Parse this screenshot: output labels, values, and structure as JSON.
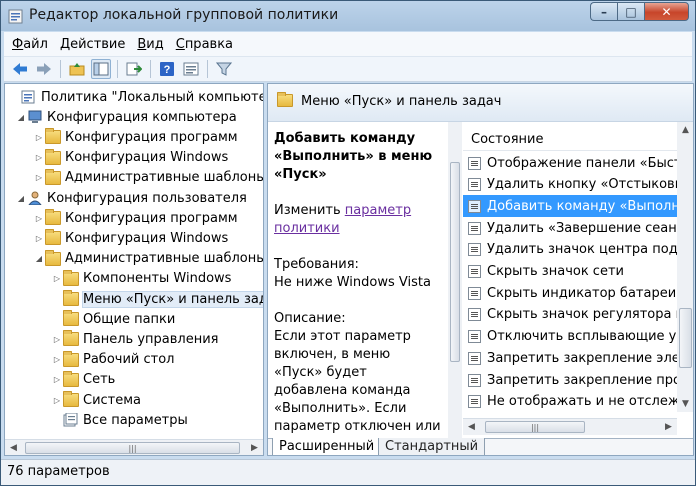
{
  "window": {
    "title": "Редактор локальной групповой политики",
    "controls": {
      "minimize": "–",
      "maximize": "□",
      "close": "✕"
    }
  },
  "menu": [
    {
      "label": "Файл",
      "accel": "Ф",
      "rest": "айл"
    },
    {
      "label": "Действие",
      "accel": "Д",
      "rest": "ействие"
    },
    {
      "label": "Вид",
      "accel": "В",
      "rest": "ид"
    },
    {
      "label": "Справка",
      "accel": "С",
      "rest": "правка"
    }
  ],
  "toolbar": {
    "buttons": [
      "back-arrow-icon",
      "forward-arrow-icon",
      "up-folder-icon",
      "show-hide-tree-icon",
      "export-list-icon",
      "help-icon",
      "properties-icon",
      "filter-icon"
    ]
  },
  "tree": {
    "items": [
      {
        "label": "Политика \"Локальный компьютер\"",
        "icon": "policy-icon",
        "depth": 0,
        "expander": ""
      },
      {
        "label": "Конфигурация компьютера",
        "icon": "computer-icon",
        "depth": 1,
        "expander": "◢"
      },
      {
        "label": "Конфигурация программ",
        "icon": "folder-icon",
        "depth": 2,
        "expander": "▷"
      },
      {
        "label": "Конфигурация Windows",
        "icon": "folder-icon",
        "depth": 2,
        "expander": "▷"
      },
      {
        "label": "Административные шаблоны",
        "icon": "folder-icon",
        "depth": 2,
        "expander": "▷"
      },
      {
        "label": "Конфигурация пользователя",
        "icon": "user-icon",
        "depth": 1,
        "expander": "◢"
      },
      {
        "label": "Конфигурация программ",
        "icon": "folder-icon",
        "depth": 2,
        "expander": "▷"
      },
      {
        "label": "Конфигурация Windows",
        "icon": "folder-icon",
        "depth": 2,
        "expander": "▷"
      },
      {
        "label": "Административные шаблоны",
        "icon": "folder-icon",
        "depth": 2,
        "expander": "◢"
      },
      {
        "label": "Компоненты Windows",
        "icon": "folder-icon",
        "depth": 3,
        "expander": "▷"
      },
      {
        "label": "Меню «Пуск» и панель задач",
        "icon": "folder-icon",
        "depth": 3,
        "expander": "",
        "selected": true
      },
      {
        "label": "Общие папки",
        "icon": "folder-icon",
        "depth": 3,
        "expander": ""
      },
      {
        "label": "Панель управления",
        "icon": "folder-icon",
        "depth": 3,
        "expander": "▷"
      },
      {
        "label": "Рабочий стол",
        "icon": "folder-icon",
        "depth": 3,
        "expander": "▷"
      },
      {
        "label": "Сеть",
        "icon": "folder-icon",
        "depth": 3,
        "expander": "▷"
      },
      {
        "label": "Система",
        "icon": "folder-icon",
        "depth": 3,
        "expander": "▷"
      },
      {
        "label": "Все параметры",
        "icon": "all-settings-icon",
        "depth": 3,
        "expander": ""
      }
    ]
  },
  "right": {
    "header_title": "Меню «Пуск» и панель задач",
    "description": {
      "title": "Добавить команду «Выполнить» в меню «Пуск»",
      "edit_prefix": "Изменить ",
      "edit_link": "параметр политики",
      "req_label": "Требования:",
      "req_value": "Не ниже Windows Vista",
      "desc_label": "Описание:",
      "desc_text": "Если этот параметр включен, в меню «Пуск» будет добавлена команда «Выполнить». Если параметр отключен или не задан"
    },
    "list": {
      "column": "Состояние",
      "rows": [
        "Отображение панели «Быстр",
        "Удалить кнопку «Отстыковка І",
        "Добавить команду «Выполни",
        "Удалить «Завершение сеанса",
        "Удалить значок центра подде",
        "Скрыть значок сети",
        "Скрыть индикатор батареи",
        "Скрыть значок регулятора гро",
        "Отключить всплывающие уве",
        "Запретить закрепление элеме",
        "Запретить закрепление прогр",
        "Не отображать и не отслежие"
      ],
      "selected_index": 2
    },
    "tabs": [
      "Расширенный",
      "Стандартный"
    ]
  },
  "status": "76 параметров"
}
